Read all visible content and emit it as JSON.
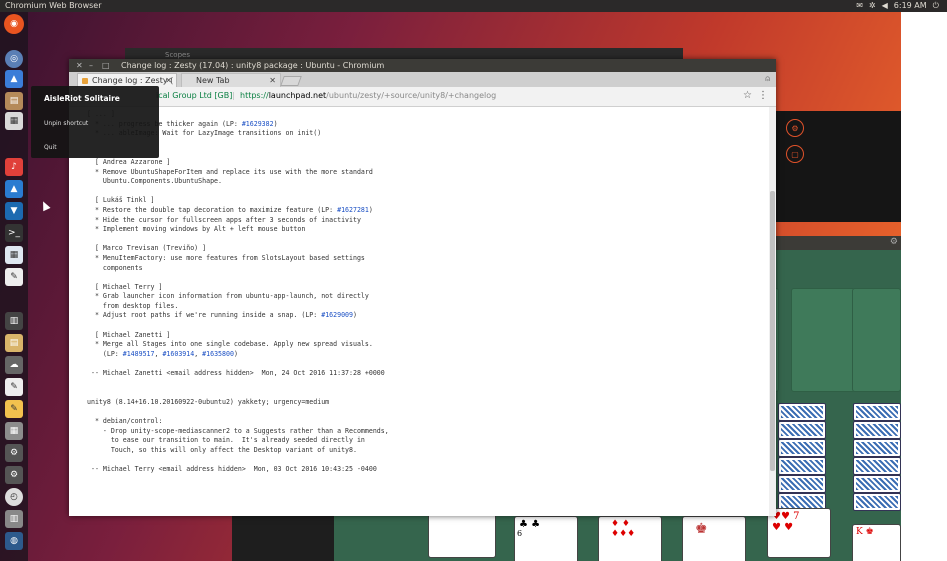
{
  "top_panel": {
    "app_title": "Chromium Web Browser",
    "time": "6:19 AM",
    "indicators": [
      "mail-icon",
      "gear-icon",
      "volume-icon",
      "power-icon"
    ]
  },
  "launcher": {
    "items": [
      "ubuntu-logo-icon",
      "chromium-icon",
      "photos-icon",
      "image-viewer-icon",
      "files-icon",
      "music-icon",
      "mahjongg-icon",
      "solitaire-icon",
      "terminal-icon",
      "calendar-icon",
      "editor-icon",
      "system-monitor-icon",
      "spreadsheet-icon",
      "chat-icon",
      "text-icon",
      "notes-icon",
      "calculator-icon",
      "settings-icon",
      "settings-icon",
      "clock-icon",
      "trash-icon",
      "workspace-icon"
    ]
  },
  "context_menu": {
    "title": "AisleRiot Solitaire",
    "items": [
      "Unpin shortcut",
      "Quit"
    ]
  },
  "scopes_window": {
    "title": "Scopes"
  },
  "browser": {
    "window_title": "Change log : Zesty (17.04) : unity8 package : Ubuntu - Chromium",
    "tabs": [
      {
        "label": "Change log : Zesty (",
        "active": true
      },
      {
        "label": "New Tab",
        "active": false
      }
    ],
    "omnibox": {
      "org": "ical Group Ltd [GB]",
      "separator": "|",
      "url_scheme": "https://",
      "url_host": "launchpad.net",
      "url_path": "/ubuntu/zesty/+source/unity8/+changelog"
    },
    "changelog_lines": [
      "[ ... ]",
      "  * ... progress be thicker again (LP: #1629382)",
      "  * ... ableImage: Wait for LazyImage transitions on init()",
      "",
      "",
      "  [ Andrea Azzarone ]",
      "  * Remove UbuntuShapeForItem and replace its use with the more standard",
      "    Ubuntu.Components.UbuntuShape.",
      "",
      "  [ Lukáš Tinkl ]",
      "  * Restore the double tap decoration to maximize feature (LP: #1627281)",
      "  * Hide the cursor for fullscreen apps after 3 seconds of inactivity",
      "  * Implement moving windows by Alt + left mouse button",
      "",
      "  [ Marco Trevisan (Treviño) ]",
      "  * MenuItemFactory: use more features from SlotsLayout based settings",
      "    components",
      "",
      "  [ Michael Terry ]",
      "  * Grab launcher icon information from ubuntu-app-launch, not directly",
      "    from desktop files.",
      "  * Adjust root paths if we're running inside a snap. (LP: #1629009)",
      "",
      "  [ Michael Zanetti ]",
      "  * Merge all Stages into one single codebase. Apply new spread visuals.",
      "    (LP: #1489517, #1603914, #1635800)",
      "",
      " -- Michael Zanetti <email address hidden>  Mon, 24 Oct 2016 11:37:28 +0000",
      "",
      "",
      "unity8 (8.14+16.10.20160922-0ubuntu2) yakkety; urgency=medium",
      "",
      "  * debian/control:",
      "    - Drop unity-scope-mediascanner2 to a Suggests rather than a Recommends,",
      "      to ease our transition to main.  It's already seeded directly in",
      "      Touch, so this will only affect the Desktop variant of unity8.",
      "",
      " -- Michael Terry <email address hidden>  Mon, 03 Oct 2016 10:43:25 -0400"
    ]
  },
  "solitaire": {
    "visible_cards": [
      "6 of clubs",
      "10 of diamonds",
      "jack",
      "7 of hearts",
      "king of hearts"
    ]
  },
  "colors": {
    "accent": "#e95420",
    "panel": "#2b2929",
    "felt": "#35654d",
    "link": "#1a4fc4",
    "secure_green": "#0b8043"
  }
}
